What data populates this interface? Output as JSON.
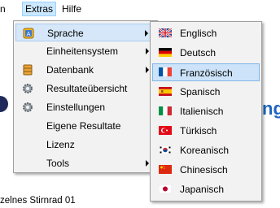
{
  "menubar": {
    "items": [
      "n",
      "Extras",
      "Hilfe"
    ],
    "active_index": 1
  },
  "main_menu": {
    "items": [
      {
        "label": "Sprache",
        "icon": "language-icon",
        "has_submenu": true,
        "highlighted": true
      },
      {
        "label": "Einheitensystem",
        "icon": null,
        "has_submenu": true
      },
      {
        "label": "Datenbank",
        "icon": "database-icon",
        "has_submenu": true
      },
      {
        "label": "Resultateübersicht",
        "icon": "gear-icon",
        "has_submenu": false
      },
      {
        "label": "Einstellungen",
        "icon": "gear-icon",
        "has_submenu": false
      },
      {
        "label": "Eigene Resultate",
        "icon": null,
        "has_submenu": false
      },
      {
        "label": "Lizenz",
        "icon": null,
        "has_submenu": false
      },
      {
        "label": "Tools",
        "icon": null,
        "has_submenu": true
      }
    ]
  },
  "language_submenu": {
    "items": [
      {
        "label": "Englisch",
        "flag": "flag-uk"
      },
      {
        "label": "Deutsch",
        "flag": "flag-de"
      },
      {
        "label": "Französisch",
        "flag": "flag-fr",
        "highlighted": true
      },
      {
        "label": "Spanisch",
        "flag": "flag-es"
      },
      {
        "label": "Italienisch",
        "flag": "flag-it"
      },
      {
        "label": "Türkisch",
        "flag": "flag-tr"
      },
      {
        "label": "Koreanisch",
        "flag": "flag-kr"
      },
      {
        "label": "Chinesisch",
        "flag": "flag-cn"
      },
      {
        "label": "Japanisch",
        "flag": "flag-jp"
      }
    ]
  },
  "background": {
    "partial_text": "ng",
    "status_text": "zelnes Stirnrad 01"
  },
  "colors": {
    "highlight_bg": "#d5e7f8",
    "highlight_border": "#aacbee",
    "menu_bg": "#f2f2f2",
    "accent_text": "#1e66c0"
  }
}
